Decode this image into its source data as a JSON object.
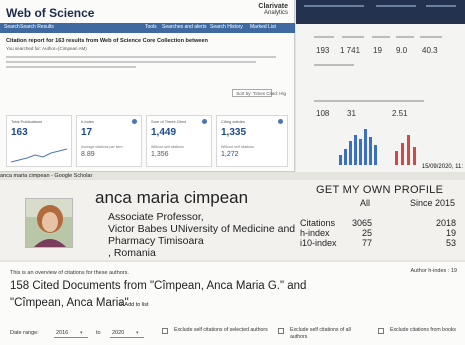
{
  "wos": {
    "logo": "Web of Science",
    "clarivate_name": "Clarivate",
    "clarivate_sub": "Analytics",
    "nav": [
      "Search",
      "Search Results",
      "Tools",
      "Searches and alerts",
      "Search History",
      "Marked List"
    ],
    "report_title": "Citation report for 163 results from Web of Science Core Collection between",
    "report_sub": "You searched for: Author=(Cimpean AM)",
    "sort_label": "Sort by:",
    "sort_value": "Times Cited: Hig",
    "boxes": [
      {
        "label": "Total Publications",
        "value": "163",
        "sub": "",
        "mid": ""
      },
      {
        "label": "h-index",
        "value": "17",
        "sub": "Average citations per item",
        "mid": "8.89"
      },
      {
        "label": "Sum of Times Cited",
        "value": "1,449",
        "sub": "Without self citations",
        "mid": "1,356"
      },
      {
        "label": "Citing articles",
        "value": "1,335",
        "sub": "Without self citations",
        "mid": "1,272"
      }
    ]
  },
  "right_panel": {
    "nums": [
      "193",
      "1 741",
      "19",
      "9.0",
      "40.3"
    ],
    "nums2": [
      "108",
      "31",
      "2.51"
    ],
    "timestamp": "15/09/2020, 11:"
  },
  "scholar": {
    "page_label": "anca maria cimpean - Google Scholar",
    "name": "anca maria cimpean",
    "lines": [
      "Associate Professor,",
      "Victor Babes UNiversity of Medicine and",
      "Pharmacy Timisoara",
      ", Romania"
    ],
    "profile_heading": "GET MY OWN PROFILE",
    "col_all": "All",
    "col_since": "Since 2015",
    "rows": [
      {
        "label": "Citations",
        "all": "3065",
        "since": "2018"
      },
      {
        "label": "h-index",
        "all": "25",
        "since": "19"
      },
      {
        "label": "i10-index",
        "all": "77",
        "since": "53"
      }
    ]
  },
  "report": {
    "overview": "This is an overview of citations for these authors.",
    "hindex": "Author h-index : 19",
    "cited_line1": "158 Cited Documents from  \"Cîmpean, Anca Maria G.\" and",
    "cited_line2": "\"Cîmpean, Anca Maria\"",
    "add_to_list": "+ Add to list",
    "date_range_label": "Date range:",
    "from_year": "2016",
    "to_label": "to",
    "to_year": "2020",
    "checkboxes": [
      "Exclude self citations of selected authors",
      "Exclude self citations of all authors",
      "Exclude citations from books"
    ]
  }
}
